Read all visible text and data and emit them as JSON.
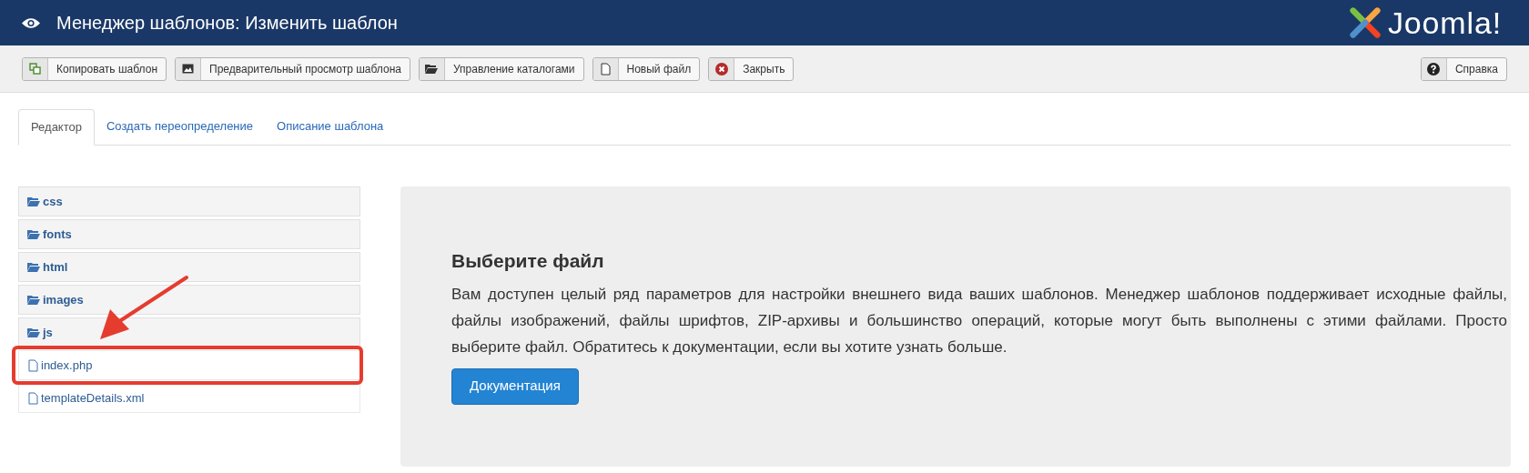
{
  "header": {
    "title": "Менеджер шаблонов: Изменить шаблон",
    "logo_text": "Joomla!"
  },
  "toolbar": {
    "buttons": [
      {
        "kind": "copy",
        "label": "Копировать шаблон"
      },
      {
        "kind": "image",
        "label": "Предварительный просмотр шаблона"
      },
      {
        "kind": "folder",
        "label": "Управление каталогами"
      },
      {
        "kind": "file",
        "label": "Новый файл"
      },
      {
        "kind": "close",
        "label": "Закрыть"
      }
    ],
    "help": {
      "kind": "help",
      "label": "Справка"
    }
  },
  "tabs": [
    {
      "label": "Редактор",
      "selected": true
    },
    {
      "label": "Создать переопределение",
      "selected": false
    },
    {
      "label": "Описание шаблона",
      "selected": false
    }
  ],
  "tree": [
    {
      "kind": "folder",
      "name": "css",
      "highlighted": false
    },
    {
      "kind": "folder",
      "name": "fonts",
      "highlighted": false
    },
    {
      "kind": "folder",
      "name": "html",
      "highlighted": false
    },
    {
      "kind": "folder",
      "name": "images",
      "highlighted": false
    },
    {
      "kind": "folder",
      "name": "js",
      "highlighted": false
    },
    {
      "kind": "file",
      "name": "index.php",
      "highlighted": true
    },
    {
      "kind": "file",
      "name": "templateDetails.xml",
      "highlighted": false
    }
  ],
  "panel": {
    "heading": "Выберите файл",
    "text": "Вам доступен целый ряд параметров для настройки внешнего вида ваших шаблонов. Менеджер шаблонов поддерживает исходные файлы, файлы изображений, файлы шрифтов, ZIP-архивы и большинство операций, которые могут быть выполнены с этими файлами. Просто выберите файл. Обратитесь к документации, если вы хотите узнать больше.",
    "button": "Документация"
  }
}
